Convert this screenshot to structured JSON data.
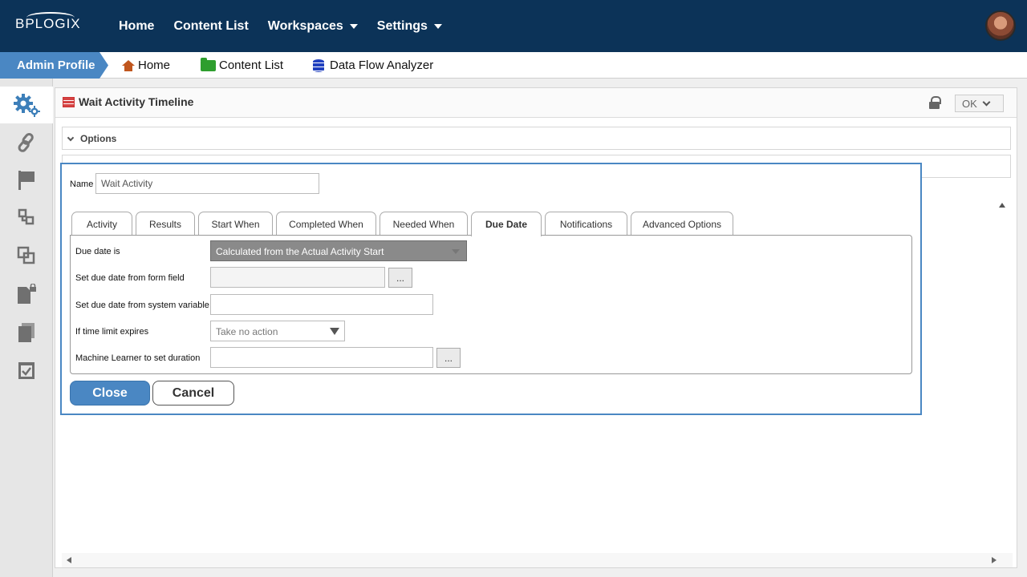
{
  "topbar": {
    "logo": "BPLOGIX",
    "nav": [
      {
        "label": "Home",
        "has_caret": false
      },
      {
        "label": "Content List",
        "has_caret": false
      },
      {
        "label": "Workspaces",
        "has_caret": true
      },
      {
        "label": "Settings",
        "has_caret": true
      }
    ]
  },
  "breadcrumb": {
    "profile": "Admin Profile",
    "home": "Home",
    "content_list": "Content List",
    "dfa": "Data Flow Analyzer"
  },
  "sidebar": {
    "items": [
      "gears-icon",
      "link-icon",
      "flag-icon",
      "hierarchy-icon",
      "copy-layers-icon",
      "locked-document-icon",
      "documents-icon",
      "checklist-icon"
    ]
  },
  "panel": {
    "title": "Wait Activity Timeline",
    "ok_label": "OK",
    "options_label": "Options"
  },
  "dialog": {
    "name_label": "Name",
    "name_value": "Wait Activity",
    "tabs": [
      {
        "label": "Activity"
      },
      {
        "label": "Results"
      },
      {
        "label": "Start When"
      },
      {
        "label": "Completed When"
      },
      {
        "label": "Needed When"
      },
      {
        "label": "Due Date",
        "active": true
      },
      {
        "label": "Notifications"
      },
      {
        "label": "Advanced Options"
      }
    ],
    "fields": {
      "due_date_label": "Due date is",
      "due_date_value": "Calculated from the Actual Activity Start",
      "form_field_label": "Set due date from form field",
      "system_var_label": "Set due date from system variable",
      "time_limit_label": "If time limit expires",
      "time_limit_value": "Take no action",
      "ml_label": "Machine Learner to set duration",
      "dots": "..."
    },
    "close_label": "Close",
    "cancel_label": "Cancel"
  }
}
